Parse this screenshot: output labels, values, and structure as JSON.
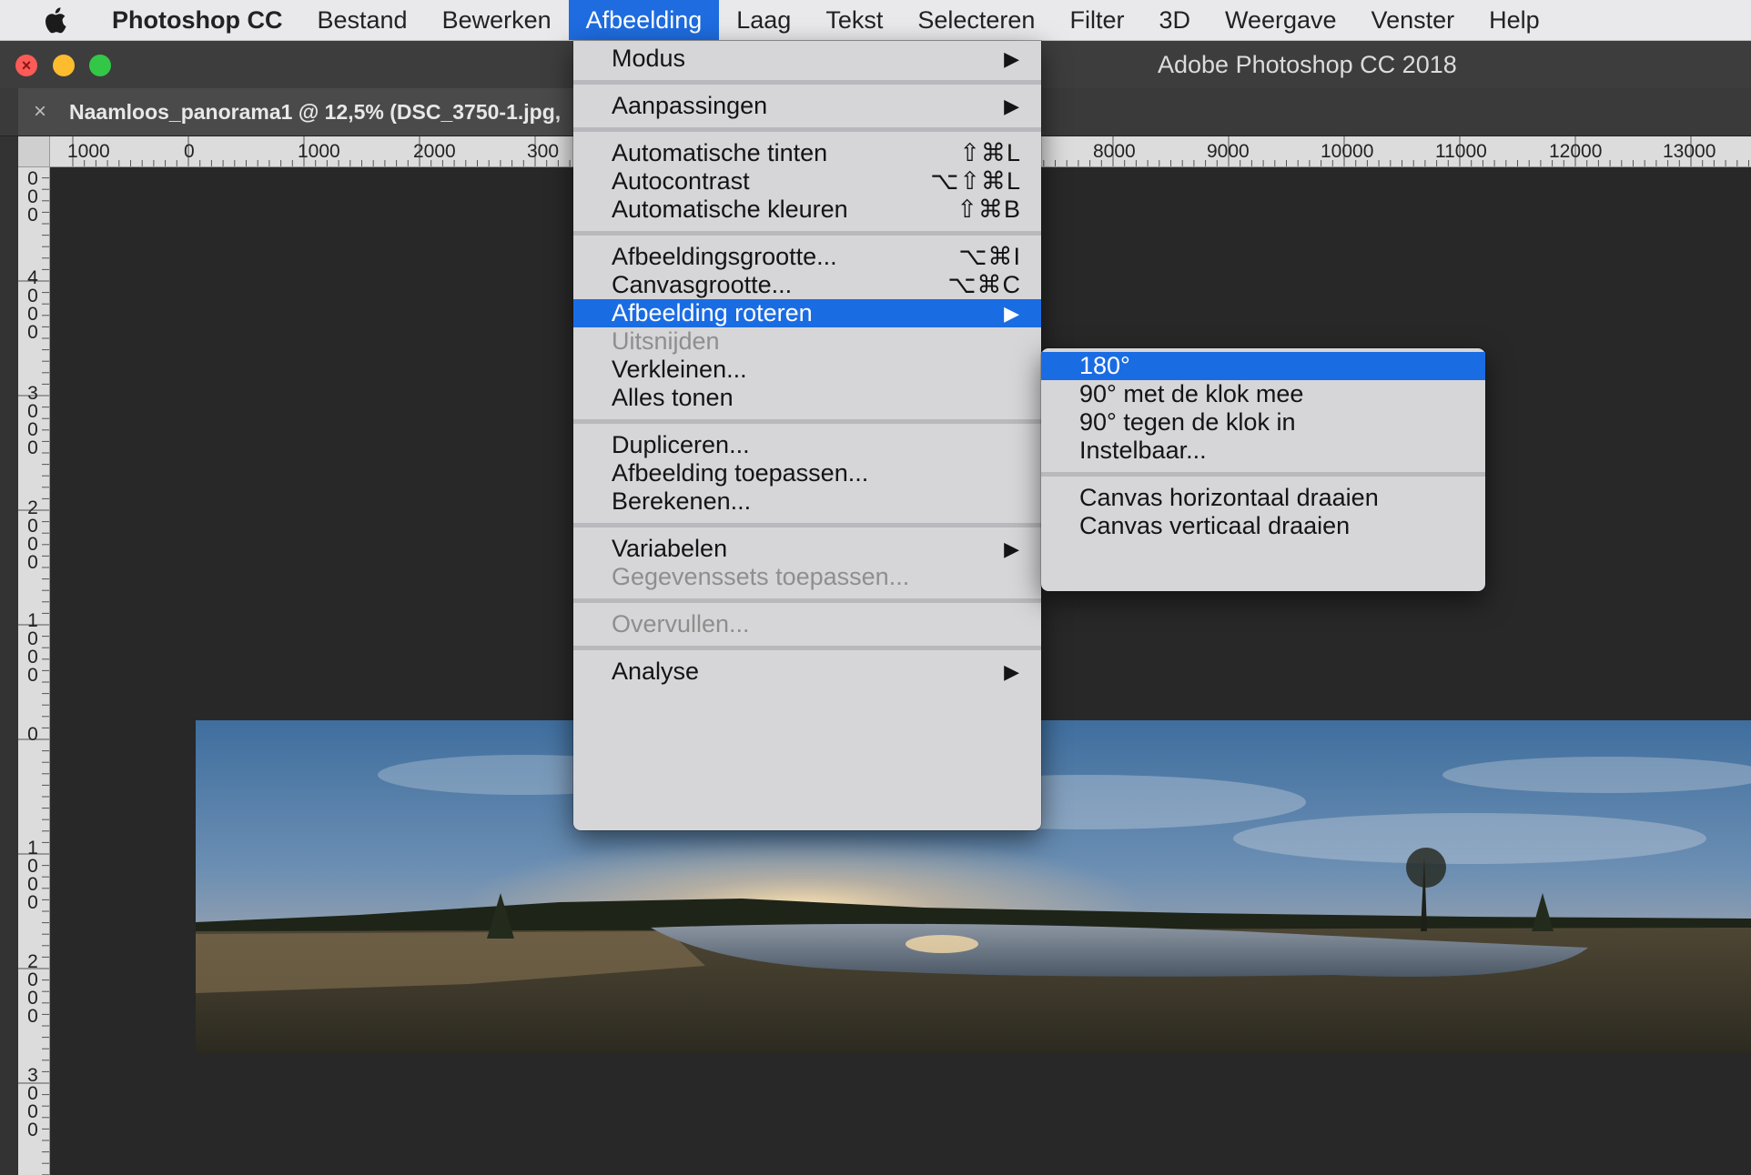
{
  "menubar": {
    "apple_icon": "apple-logo-icon",
    "items": [
      "Photoshop CC",
      "Bestand",
      "Bewerken",
      "Afbeelding",
      "Laag",
      "Tekst",
      "Selecteren",
      "Filter",
      "3D",
      "Weergave",
      "Venster",
      "Help"
    ],
    "active": "Afbeelding"
  },
  "window": {
    "title": "Adobe Photoshop CC 2018",
    "tab_title": "Naamloos_panorama1 @ 12,5% (DSC_3750-1.jpg,"
  },
  "rulers": {
    "horizontal_labels": [
      "1000",
      "0",
      "1000",
      "2000",
      "300",
      "8000",
      "9000",
      "10000",
      "11000",
      "12000",
      "13000"
    ],
    "vertical_labels": [
      "000",
      "4000",
      "3000",
      "2000",
      "1000",
      "0",
      "1000",
      "2000",
      "3000"
    ]
  },
  "afbeelding_menu": {
    "groups": [
      [
        {
          "label": "Modus",
          "submenu": true
        }
      ],
      [
        {
          "label": "Aanpassingen",
          "submenu": true
        }
      ],
      [
        {
          "label": "Automatische tinten",
          "shortcut": "⇧⌘L"
        },
        {
          "label": "Autocontrast",
          "shortcut": "⌥⇧⌘L"
        },
        {
          "label": "Automatische kleuren",
          "shortcut": "⇧⌘B"
        }
      ],
      [
        {
          "label": "Afbeeldingsgrootte...",
          "shortcut": "⌥⌘I"
        },
        {
          "label": "Canvasgrootte...",
          "shortcut": "⌥⌘C"
        },
        {
          "label": "Afbeelding roteren",
          "submenu": true,
          "highlighted": true
        },
        {
          "label": "Uitsnijden",
          "disabled": true
        },
        {
          "label": "Verkleinen..."
        },
        {
          "label": "Alles tonen"
        }
      ],
      [
        {
          "label": "Dupliceren..."
        },
        {
          "label": "Afbeelding toepassen..."
        },
        {
          "label": "Berekenen..."
        }
      ],
      [
        {
          "label": "Variabelen",
          "submenu": true
        },
        {
          "label": "Gegevenssets toepassen...",
          "disabled": true
        }
      ],
      [
        {
          "label": "Overvullen...",
          "disabled": true
        }
      ],
      [
        {
          "label": "Analyse",
          "submenu": true
        }
      ]
    ]
  },
  "roteren_submenu": {
    "groups": [
      [
        {
          "label": "180°",
          "highlighted": true
        },
        {
          "label": "90° met de klok mee"
        },
        {
          "label": "90° tegen de klok in"
        },
        {
          "label": "Instelbaar..."
        }
      ],
      [
        {
          "label": "Canvas horizontaal draaien"
        },
        {
          "label": "Canvas verticaal draaien"
        }
      ]
    ]
  },
  "colors": {
    "highlight": "#1a6ce3",
    "canvas_bg": "#282828",
    "menu_bg": "#d6d6d8"
  }
}
